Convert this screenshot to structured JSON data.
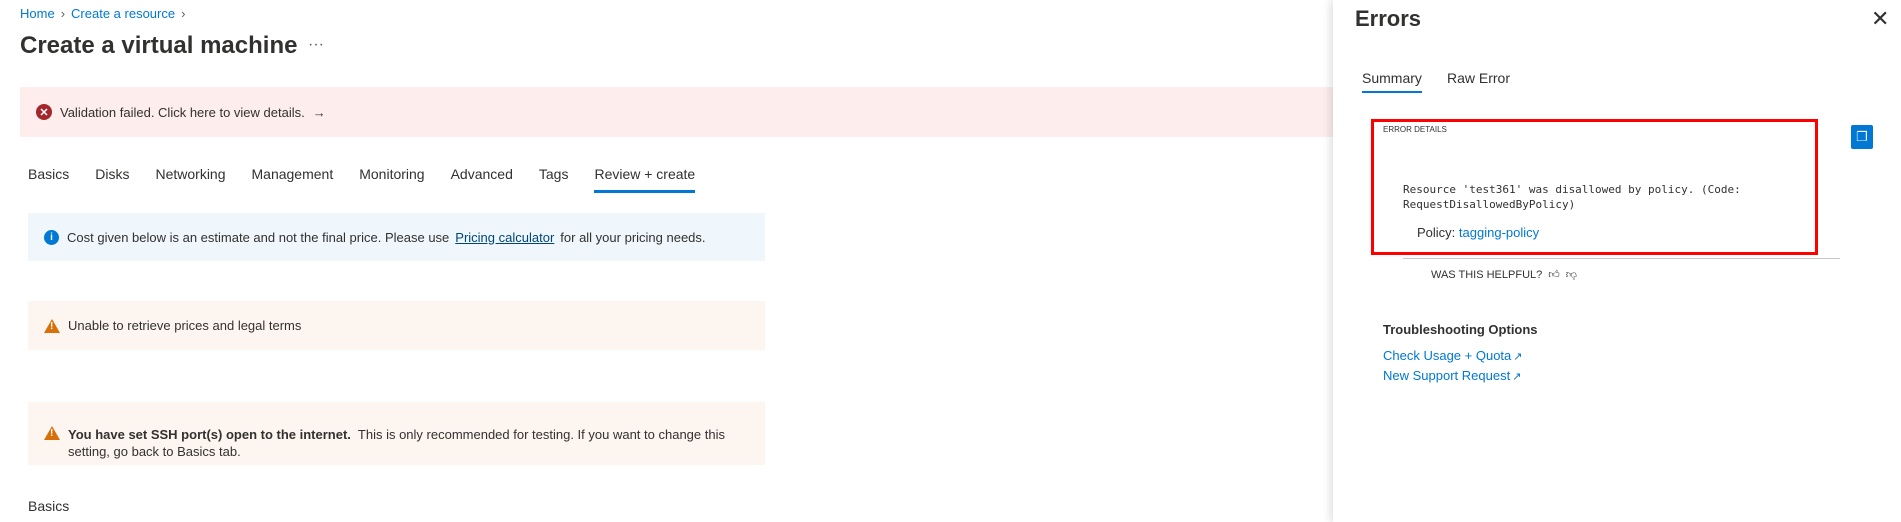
{
  "breadcrumb": [
    "Home",
    "Create a resource"
  ],
  "title": "Create a virtual machine",
  "more": "···",
  "validation": {
    "text": "Validation failed. Click here to view details.",
    "arrow": "→",
    "icon": "error-circle-icon"
  },
  "tabs": [
    "Basics",
    "Disks",
    "Networking",
    "Management",
    "Monitoring",
    "Advanced",
    "Tags",
    "Review + create"
  ],
  "active_tab": "Review + create",
  "info": {
    "before": "Cost given below is an estimate and not the final price. Please use",
    "link": "Pricing calculator",
    "after": "for all your pricing needs."
  },
  "warning1": "Unable to retrieve prices and legal terms",
  "warning2": {
    "bold": "You have set SSH port(s) open to the internet.",
    "text": "This is only recommended for testing.  If you want to change this setting, go back to Basics tab."
  },
  "section": "Basics",
  "panel": {
    "title": "Errors",
    "tabs": [
      "Summary",
      "Raw Error"
    ],
    "error_label": "ERROR DETAILS",
    "message": "Resource 'test361' was disallowed by policy. (Code: RequestDisallowedByPolicy)",
    "policy_label": "Policy:",
    "policy_link": "tagging-policy",
    "helpful": "WAS THIS HELPFUL?",
    "troubleshooting": "Troubleshooting Options",
    "links": [
      "Check Usage + Quota",
      "New Support Request"
    ]
  },
  "colors": {
    "accent": "#0078d4",
    "error": "#a4262c",
    "warning": "#d8700a",
    "highlight": "#ff0000"
  }
}
